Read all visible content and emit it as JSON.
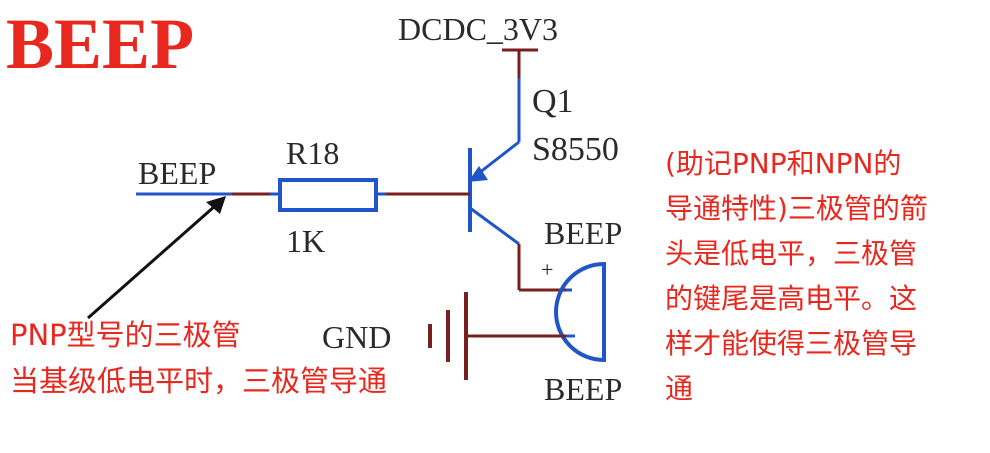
{
  "title": "BEEP",
  "labels": {
    "power": "DCDC_3V3",
    "transistor_ref": "Q1",
    "transistor_part": "S8550",
    "resistor_ref": "R18",
    "resistor_value": "1K",
    "net_in": "BEEP",
    "buzzer_top": "BEEP",
    "buzzer_bottom": "BEEP",
    "gnd": "GND",
    "plus": "+"
  },
  "notes": {
    "left": [
      "PNP型号的三极管",
      "当基级低电平时，三极管导通"
    ],
    "right": [
      "(助记PNP和NPN的",
      "导通特性)三极管的箭",
      "头是低电平，三极管",
      "的键尾是高电平。这",
      "样才能使得三极管导",
      "通"
    ]
  },
  "colors": {
    "title": "#e8281e",
    "wire": "#7a1f1f",
    "component": "#1f55c8",
    "label": "#2a2a2a",
    "note": "#e8281e",
    "arrow": "#111111"
  }
}
